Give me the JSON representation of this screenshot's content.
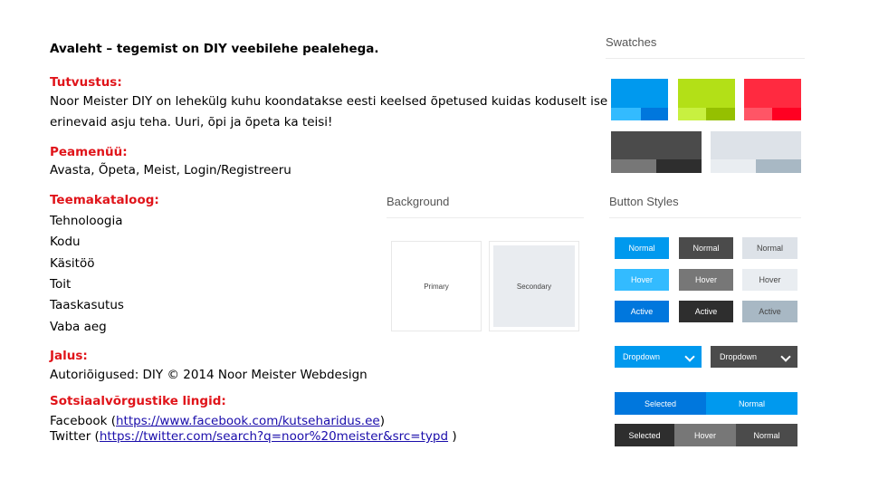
{
  "doc": {
    "heading": "Avaleht – tegemist on DIY veebilehe pealehega.",
    "intro_label": "Tutvustus:",
    "intro_line1": "Noor Meister DIY on lehekülg kuhu koondatakse eesti keelsed õpetused kuidas koduselt ise",
    "intro_line2": "erinevaid asju teha. Uuri, õpi ja õpeta ka teisi!",
    "menu_label": "Peamenüü:",
    "menu_items": "Avasta, Õpeta, Meist, Login/Registreeru",
    "catalog_label": "Teemakataloog:",
    "catalog_items": [
      "Tehnoloogia",
      "Kodu",
      "Käsitöö",
      "Toit",
      "Taaskasutus",
      "Vaba aeg"
    ],
    "footer_label": "Jalus:",
    "footer_text": "Autoriõigused: DIY © 2014 Noor Meister Webdesign",
    "social_label": "Sotsiaalvõrgustike lingid:",
    "facebook_prefix": "Facebook (",
    "facebook_url": "https://www.facebook.com/kutseharidus.ee",
    "facebook_suffix": ")",
    "twitter_prefix": "Twitter (",
    "twitter_url": "https://twitter.com/search?q=noor%20meister&src=typd",
    "twitter_suffix": " )"
  },
  "background": {
    "title": "Background",
    "primary": "Primary",
    "secondary": "Secondary"
  },
  "swatches": {
    "title": "Swatches",
    "colors": {
      "blue": "#0099ee",
      "blue_light": "#33bbff",
      "blue_dark": "#0077dd",
      "green": "#b3e017",
      "green_light": "#c8f040",
      "green_dark": "#95c000",
      "red": "#ff2a40",
      "red_light": "#ff5566",
      "red_dark": "#ff0022",
      "darkgray": "#4b4b4b",
      "darkgray_light": "#777777",
      "darkgray_dark": "#2e2e2e",
      "lightgray": "#dde2e8",
      "lightgray_light": "#e9edf1",
      "lightgray_dark": "#a8b8c4"
    }
  },
  "buttons": {
    "title": "Button Styles",
    "normal": "Normal",
    "hover": "Hover",
    "active": "Active",
    "dropdown": "Dropdown",
    "selected": "Selected"
  }
}
